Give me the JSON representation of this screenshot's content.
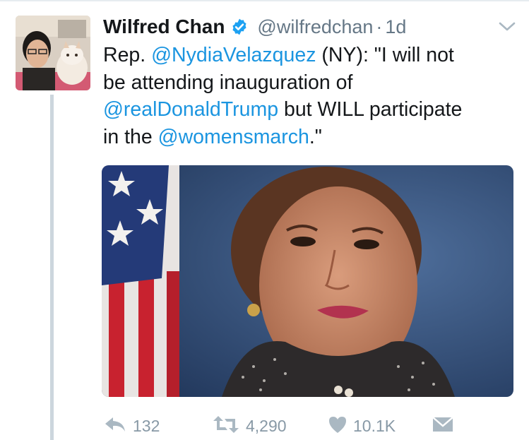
{
  "tweet": {
    "author": {
      "display_name": "Wilfred Chan",
      "handle": "@wilfredchan",
      "separator": "·",
      "time": "1d",
      "verified": true
    },
    "text": {
      "line1": {
        "prefix": "Rep. ",
        "mention": "@NydiaVelazquez",
        "suffix": " (NY): \"I will not"
      },
      "line2": {
        "text": "be attending inauguration of"
      },
      "line3": {
        "mention": "@realDonaldTrump",
        "suffix": " but WILL participate"
      },
      "line4": {
        "prefix": "in the ",
        "mention": "@womensmarch",
        "suffix": ".\""
      }
    },
    "actions": {
      "replies": "132",
      "retweets": "4,290",
      "likes": "10.1K"
    }
  },
  "colors": {
    "link": "#1b95e0",
    "secondary_text": "#657786",
    "action_icon": "#aab8c2",
    "verified_badge": "#1da1f2"
  },
  "icons": [
    "verified-badge-icon",
    "chevron-down-icon",
    "reply-icon",
    "retweet-icon",
    "heart-icon",
    "direct-message-icon"
  ]
}
